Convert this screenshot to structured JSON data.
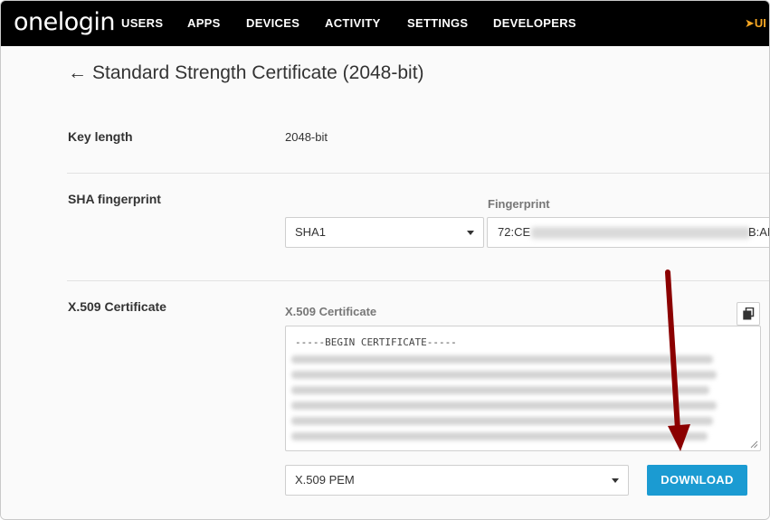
{
  "nav": {
    "logo": "onelogin",
    "items": [
      "USERS",
      "APPS",
      "DEVICES",
      "ACTIVITY",
      "SETTINGS",
      "DEVELOPERS"
    ],
    "extra": "UI"
  },
  "page": {
    "title": "Standard Strength Certificate (2048-bit)",
    "back_icon": "←"
  },
  "key_length": {
    "label": "Key length",
    "value": "2048-bit"
  },
  "sha": {
    "label": "SHA fingerprint",
    "algorithm": "SHA1",
    "fingerprint_label": "Fingerprint",
    "fingerprint_start": "72:CE",
    "fingerprint_end": "B:AE"
  },
  "x509": {
    "label": "X.509 Certificate",
    "field_label": "X.509 Certificate",
    "begin_line": "-----BEGIN CERTIFICATE-----",
    "format": "X.509 PEM",
    "download_label": "DOWNLOAD"
  },
  "colors": {
    "accent": "#1b9bd2",
    "nav_bg": "#000000",
    "annotation_arrow": "#8b0000"
  }
}
